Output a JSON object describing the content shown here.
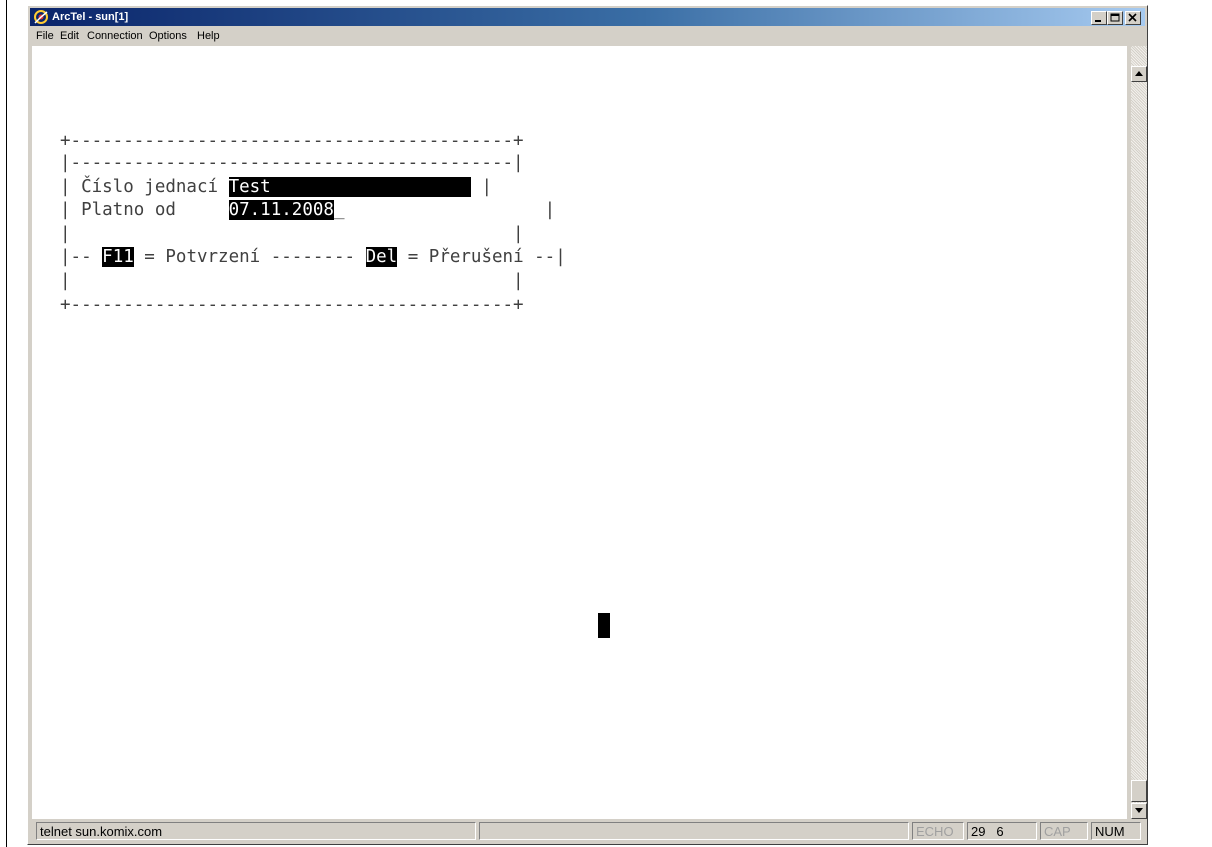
{
  "window": {
    "title": "ArcTel - sun[1]",
    "icon": "arctel-app-icon"
  },
  "menu": [
    "File",
    "Edit",
    "Connection",
    "Options",
    "Help"
  ],
  "terminal": {
    "border_top": "+------------------------------------------+",
    "separator": "|------------------------------------------|",
    "field1": {
      "label": "| Číslo jednací ",
      "value": "Test                   ",
      "end": " |"
    },
    "field2": {
      "label": "| Platno od     ",
      "value": "07.11.2008",
      "cursor": "_",
      "end": "                   |"
    },
    "empty_line": "|                                          |",
    "keys": {
      "prefix": "|-- ",
      "f11": "F11",
      "f11_desc": " = Potvrzení -------- ",
      "del": "Del",
      "del_desc": " = Přerušení --|"
    },
    "border_bottom": "+------------------------------------------+"
  },
  "status": {
    "connection": "telnet sun.komix.com",
    "echo": "ECHO",
    "row": "29",
    "col": "6",
    "cap": "CAP",
    "num": "NUM"
  }
}
